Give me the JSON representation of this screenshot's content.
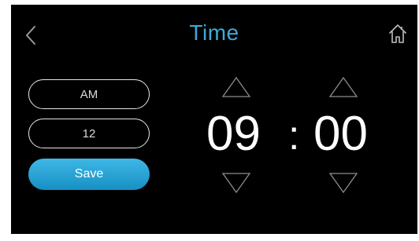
{
  "header": {
    "title": "Time",
    "back_icon": "chevron-left-icon",
    "home_icon": "home-icon"
  },
  "settings": {
    "period": "AM",
    "hour_format": "12",
    "save_label": "Save"
  },
  "time": {
    "hours": "09",
    "separator": ":",
    "minutes": "00"
  },
  "colors": {
    "background": "#000000",
    "accent": "#3fa9d6",
    "save_button": "#1ea3d8",
    "text": "#ffffff"
  }
}
